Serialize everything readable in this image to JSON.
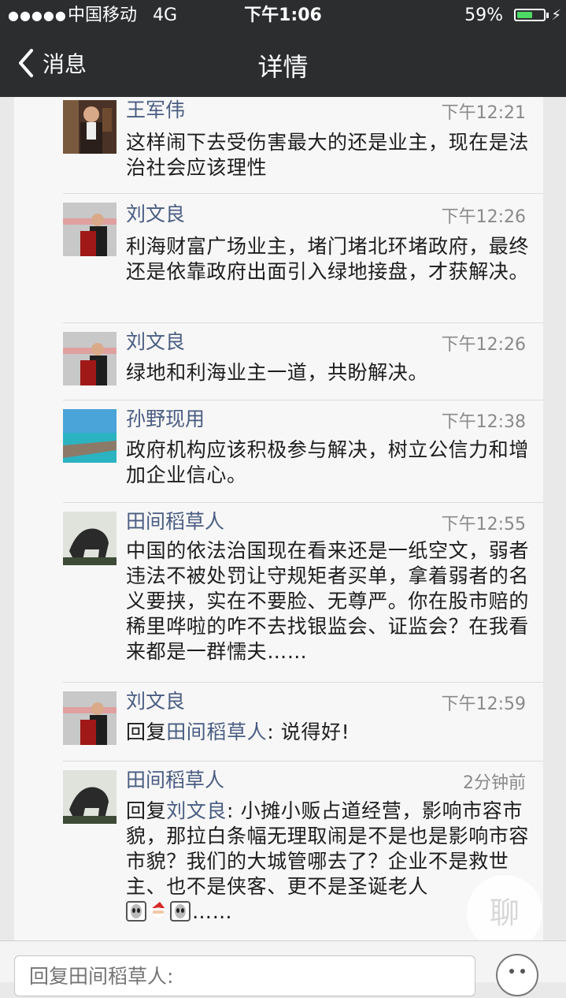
{
  "status_bar": {
    "signal": "●●●●●",
    "carrier": "中国移动",
    "network": "4G",
    "time": "下午1:06",
    "battery": "59%",
    "battery_level": 0.59,
    "charge_icon": "⚡"
  },
  "nav": {
    "back_label": "消息",
    "title": "详情"
  },
  "messages": [
    {
      "name": "王军伟",
      "time": "下午12:21",
      "text": "这样闹下去受伤害最大的还是业主，现在是法治社会应该理性",
      "avatar": "bartender-avatar"
    },
    {
      "name": "刘文良",
      "time": "下午12:26",
      "text": "利海财富广场业主，堵门堵北环堵政府，最终还是依靠政府出面引入绿地接盘，才获解决。",
      "avatar": "speaker-avatar"
    },
    {
      "name": "刘文良",
      "time": "下午12:26",
      "text": "绿地和利海业主一道，共盼解决。",
      "avatar": "speaker-avatar"
    },
    {
      "name": "孙野现用",
      "time": "下午12:38",
      "text": "政府机构应该积极参与解决，树立公信力和增加企业信心。",
      "avatar": "beach-avatar"
    },
    {
      "name": "田间稻草人",
      "time": "下午12:55",
      "text": "中国的依法治国现在看来还是一纸空文，弱者违法不被处罚让守规矩者买单，拿着弱者的名义要挟，实在不要脸、无尊严。你在股市赔的稀里哗啦的咋不去找银监会、证监会？在我看来都是一群懦夫……",
      "avatar": "horse-avatar"
    },
    {
      "name": "刘文良",
      "time": "下午12:59",
      "reply_prefix": "回复",
      "reply_to": "田间稻草人",
      "text": ": 说得好!",
      "avatar": "speaker-avatar"
    },
    {
      "name": "田间稻草人",
      "time": "2分钟前",
      "reply_prefix": "回复",
      "reply_to": "刘文良",
      "text": ": 小摊小贩占道经营，影响市容市貌，那拉白条幅无理取闹是不是也是影响市容市貌？我们的大城管哪去了？企业不是救世主、也不是侠客、更不是圣诞老人",
      "trailing": "……",
      "emojis": [
        "alien-emoji",
        "santa-emoji",
        "alien-emoji"
      ],
      "avatar": "horse-avatar"
    }
  ],
  "watermark": "聊",
  "input": {
    "placeholder": "回复田间稻草人:"
  },
  "colors": {
    "nav_bg": "#2b2d2f",
    "name_color": "#4a5d82",
    "battery_green": "#4cd964"
  }
}
